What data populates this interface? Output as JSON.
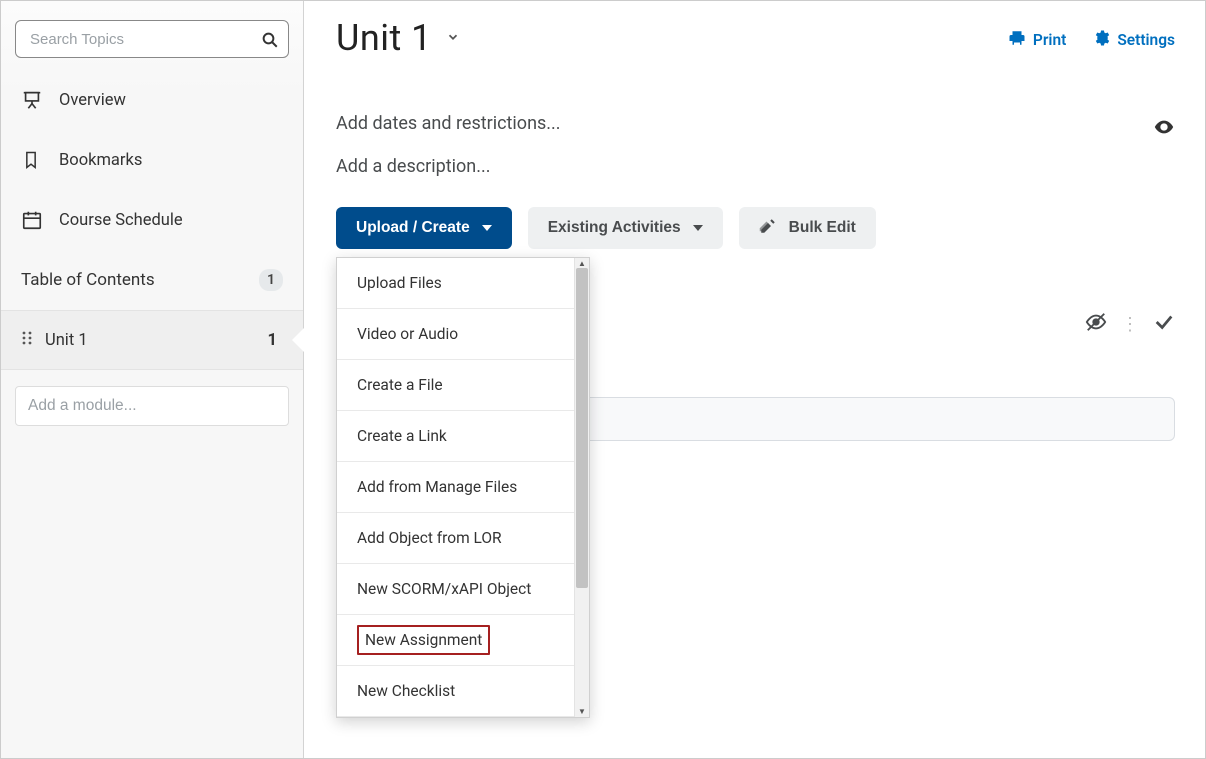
{
  "sidebar": {
    "search_placeholder": "Search Topics",
    "nav": {
      "overview": "Overview",
      "bookmarks": "Bookmarks",
      "schedule": "Course Schedule"
    },
    "toc": {
      "label": "Table of Contents",
      "count": "1"
    },
    "unit": {
      "label": "Unit 1",
      "count": "1"
    },
    "add_module_placeholder": "Add a module..."
  },
  "header": {
    "title": "Unit 1",
    "print": "Print",
    "settings": "Settings"
  },
  "main": {
    "dates_link": "Add dates and restrictions...",
    "desc_link": "Add a description...",
    "buttons": {
      "upload": "Upload / Create",
      "existing": "Existing Activities",
      "bulk": "Bulk Edit"
    }
  },
  "dropdown": {
    "items": [
      "Upload Files",
      "Video or Audio",
      "Create a File",
      "Create a Link",
      "Add from Manage Files",
      "Add Object from LOR",
      "New SCORM/xAPI Object",
      "New Assignment",
      "New Checklist"
    ],
    "highlighted_index": 7
  }
}
